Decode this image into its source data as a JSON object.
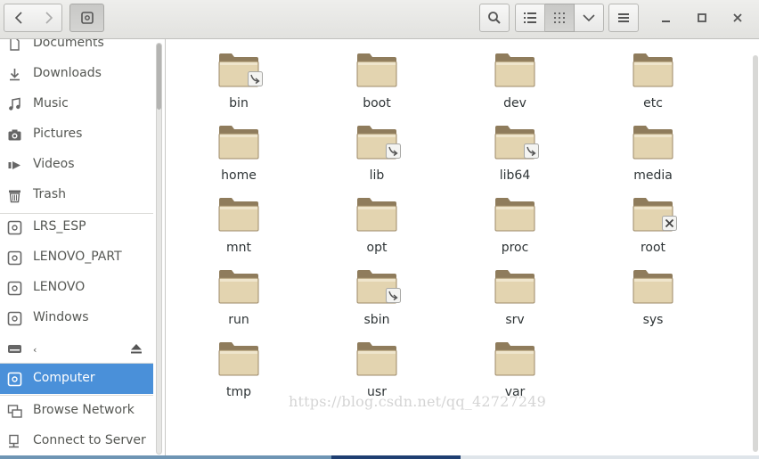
{
  "sidebar": {
    "items": [
      {
        "label": "Documents",
        "icon": "document-icon"
      },
      {
        "label": "Downloads",
        "icon": "download-icon"
      },
      {
        "label": "Music",
        "icon": "music-icon"
      },
      {
        "label": "Pictures",
        "icon": "camera-icon"
      },
      {
        "label": "Videos",
        "icon": "video-icon"
      },
      {
        "label": "Trash",
        "icon": "trash-icon"
      },
      {
        "label": "LRS_ESP",
        "icon": "drive-icon"
      },
      {
        "label": "LENOVO_PART",
        "icon": "drive-icon"
      },
      {
        "label": "LENOVO",
        "icon": "drive-icon"
      },
      {
        "label": "Windows",
        "icon": "drive-icon"
      },
      {
        "label": "‹",
        "icon": "harddisk-icon"
      },
      {
        "label": "Computer",
        "icon": "computer-icon",
        "selected": true
      },
      {
        "label": "Browse Network",
        "icon": "network-icon"
      },
      {
        "label": "Connect to Server",
        "icon": "server-icon"
      }
    ]
  },
  "files": [
    {
      "name": "bin",
      "emblem": "symlink"
    },
    {
      "name": "boot"
    },
    {
      "name": "dev"
    },
    {
      "name": "etc"
    },
    {
      "name": "home"
    },
    {
      "name": "lib",
      "emblem": "symlink"
    },
    {
      "name": "lib64",
      "emblem": "symlink"
    },
    {
      "name": "media"
    },
    {
      "name": "mnt"
    },
    {
      "name": "opt"
    },
    {
      "name": "proc"
    },
    {
      "name": "root",
      "emblem": "no-access"
    },
    {
      "name": "run"
    },
    {
      "name": "sbin",
      "emblem": "symlink"
    },
    {
      "name": "srv"
    },
    {
      "name": "sys"
    },
    {
      "name": "tmp"
    },
    {
      "name": "usr"
    },
    {
      "name": "var"
    }
  ],
  "watermark": "https://blog.csdn.net/qq_42727249",
  "colors": {
    "selection": "#4a90d9",
    "folder_light": "#e6d8b6",
    "folder_dark": "#8f7c5c"
  }
}
